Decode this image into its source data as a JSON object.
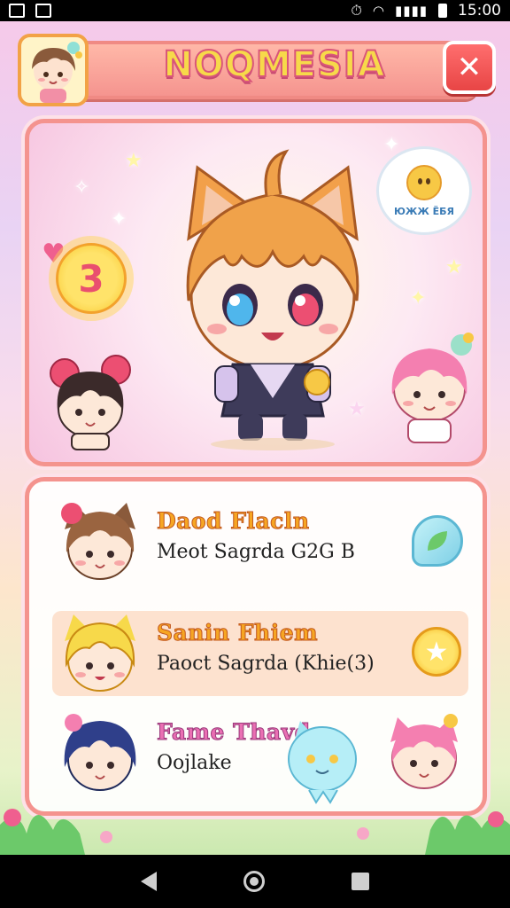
{
  "status_bar": {
    "time": "15:00",
    "icons": [
      "image-icon",
      "lock-icon",
      "alarm-icon",
      "wifi-icon",
      "signal-icon",
      "battery-icon"
    ]
  },
  "header": {
    "title": "NOQMESIA",
    "close_label": "✕",
    "avatar": "player-avatar"
  },
  "hero": {
    "level_badge": "3",
    "bubble_text": "ЮЖЖ ЁБЯ",
    "main_character": "cat-eared-hero"
  },
  "character_list": [
    {
      "name": "Daod Flacln",
      "detail": "Meot Sagrda G2G B",
      "name_color": "orange",
      "action_icon": "leaf-icon",
      "selected": false
    },
    {
      "name": "Sanin Fhiem",
      "detail": "Paoct Sagrda (Khie(3)",
      "name_color": "orange",
      "action_icon": "star-icon",
      "selected": true
    },
    {
      "name": "Fame Thavd",
      "detail": "Oojlake",
      "name_color": "pink",
      "action_icon": "none",
      "selected": false
    }
  ],
  "colors": {
    "accent": "#f4938e",
    "title_fill": "#f7d94a",
    "close_button": "#e84545",
    "selected_row": "#fde2cf"
  },
  "nav_bar": {
    "buttons": [
      "back-icon",
      "home-icon",
      "recents-icon"
    ]
  }
}
